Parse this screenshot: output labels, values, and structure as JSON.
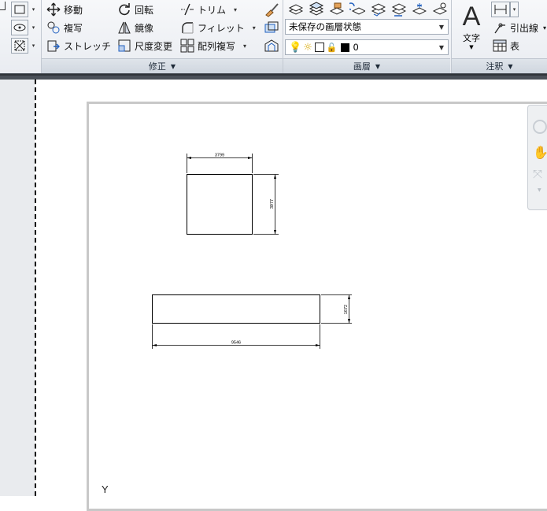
{
  "ribbon": {
    "modify_panel": {
      "title": "修正",
      "tools": {
        "move": "移動",
        "rotate": "回転",
        "trim": "トリム",
        "copy": "複写",
        "mirror": "鏡像",
        "fillet": "フィレット",
        "stretch": "ストレッチ",
        "scale": "尺度変更",
        "array": "配列複写"
      }
    },
    "layers_panel": {
      "title": "画層",
      "layer_state": "未保存の画層状態",
      "current_layer": "0"
    },
    "annotation_panel": {
      "title": "注釈",
      "text_label": "文字",
      "leader_label": "引出線",
      "table_label": "表"
    }
  },
  "drawing": {
    "dim_top_width": "3799",
    "dim_right_height": "3977",
    "dim_bottom_width": "9546",
    "dim_side_height": "1672",
    "ucs_label": "Y"
  },
  "colors": {
    "ribbon_bg": "#eceef2",
    "dark_separator": "#4a5058",
    "left_gutter": "#e9ebee"
  }
}
